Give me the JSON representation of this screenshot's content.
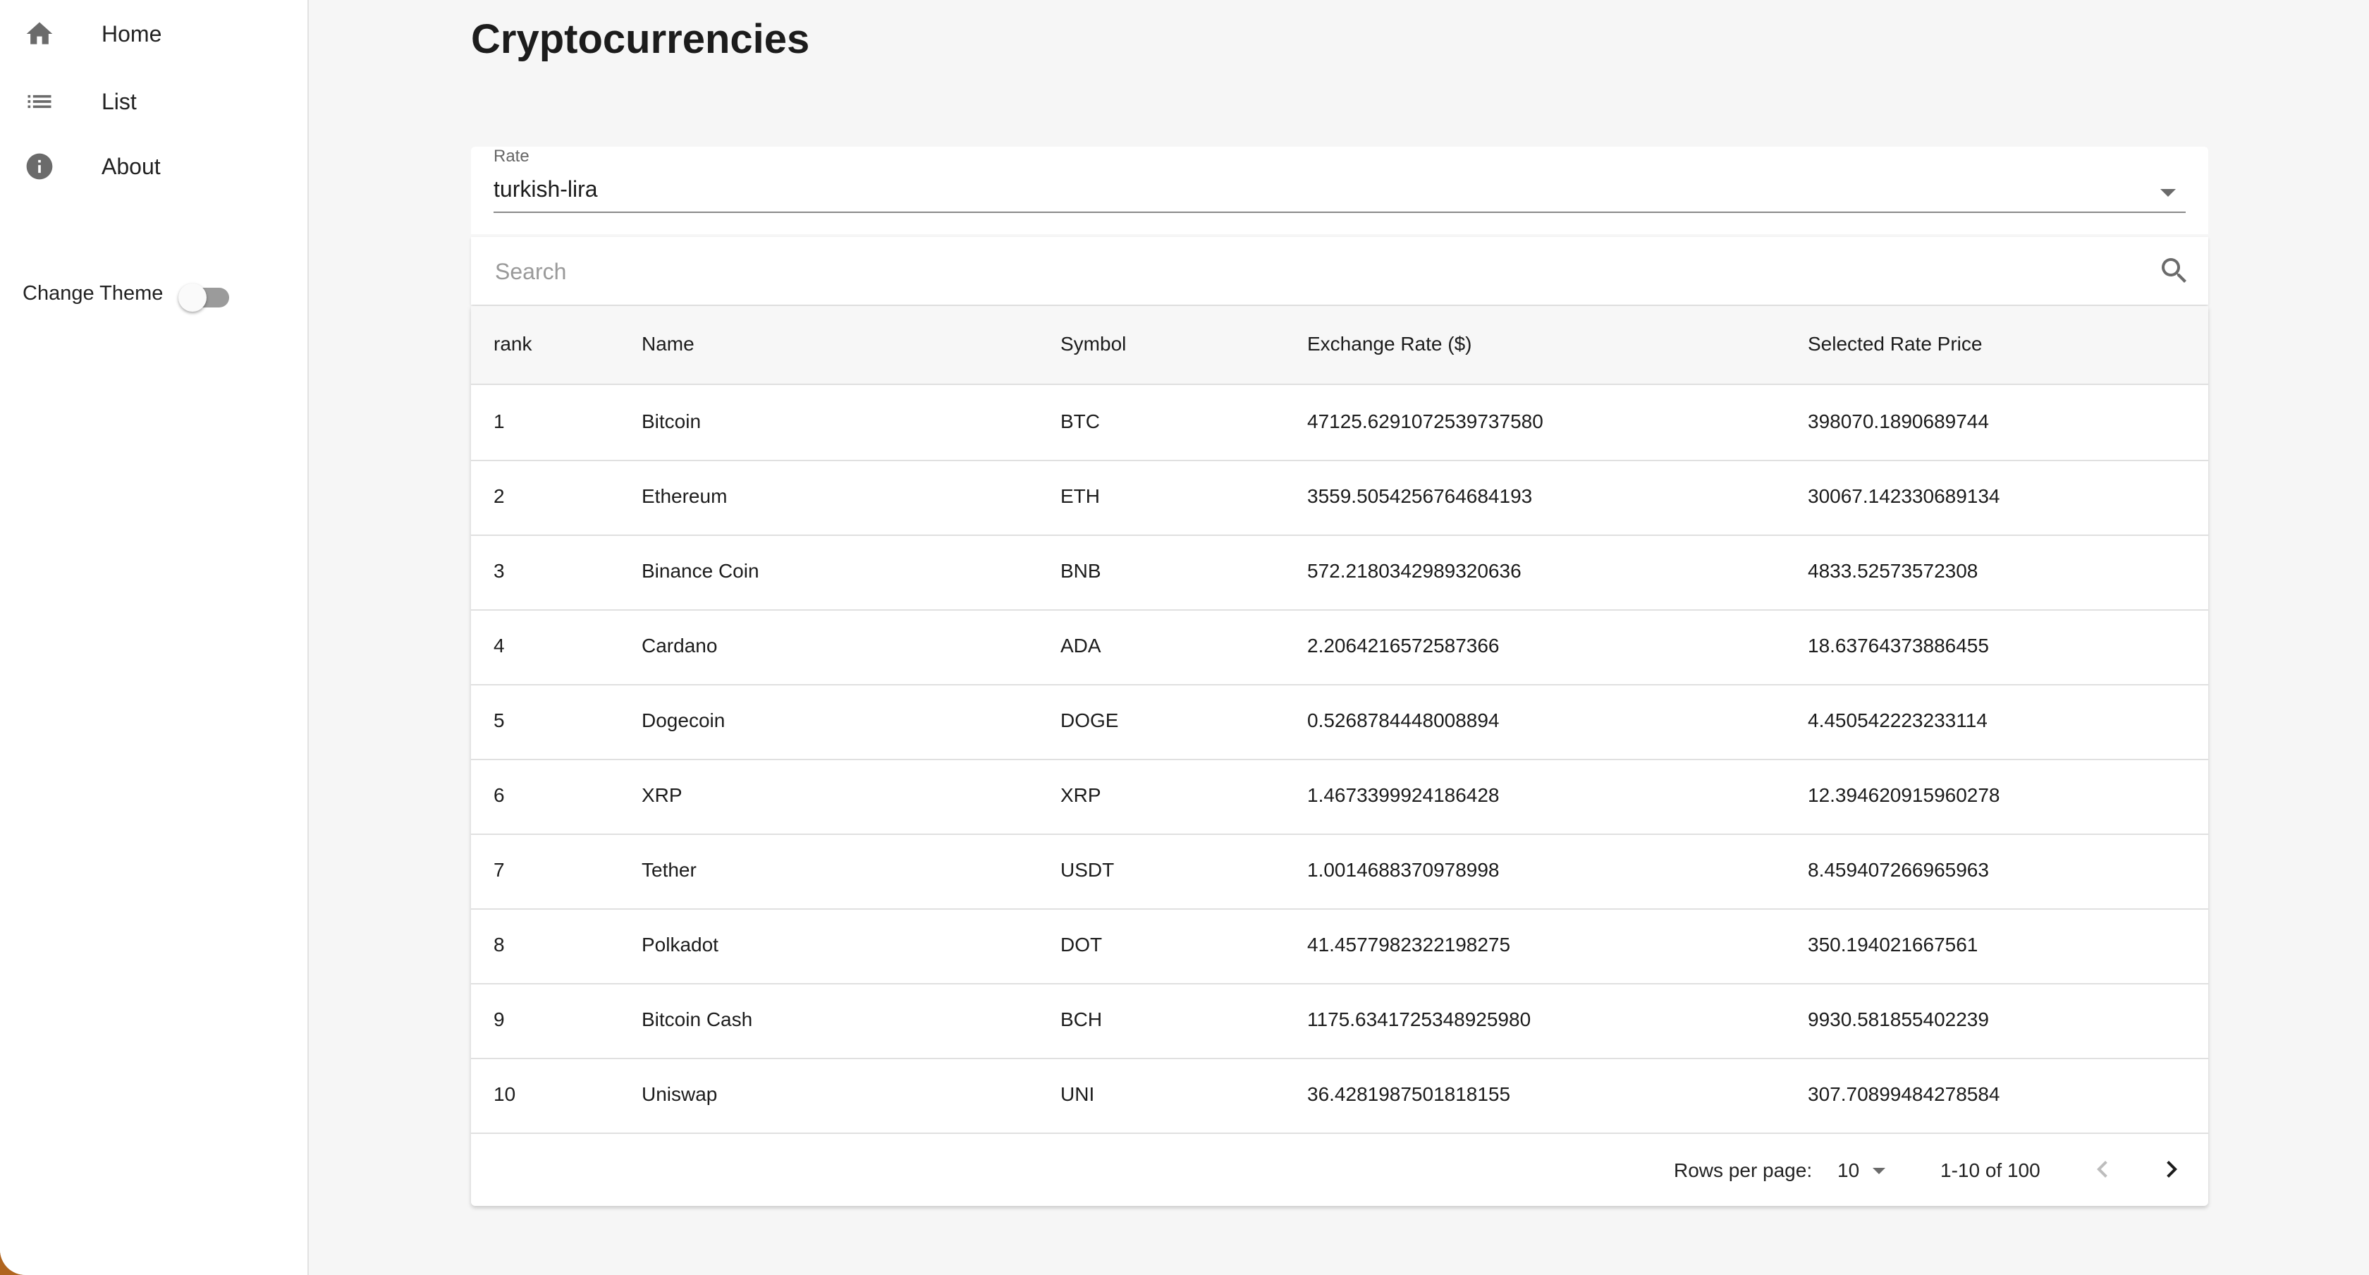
{
  "sidebar": {
    "items": [
      {
        "label": "Home",
        "icon": "home-icon"
      },
      {
        "label": "List",
        "icon": "list-icon"
      },
      {
        "label": "About",
        "icon": "info-icon"
      }
    ],
    "theme_label": "Change Theme",
    "theme_dark": false
  },
  "main": {
    "title": "Cryptocurrencies",
    "rate": {
      "caption": "Rate",
      "value": "turkish-lira"
    },
    "search": {
      "placeholder": "Search"
    },
    "table": {
      "headers": [
        "rank",
        "Name",
        "Symbol",
        "Exchange Rate ($)",
        "Selected Rate Price"
      ],
      "rows": [
        [
          "1",
          "Bitcoin",
          "BTC",
          "47125.6291072539737580",
          "398070.1890689744"
        ],
        [
          "2",
          "Ethereum",
          "ETH",
          "3559.5054256764684193",
          "30067.142330689134"
        ],
        [
          "3",
          "Binance Coin",
          "BNB",
          "572.2180342989320636",
          "4833.52573572308"
        ],
        [
          "4",
          "Cardano",
          "ADA",
          "2.2064216572587366",
          "18.63764373886455"
        ],
        [
          "5",
          "Dogecoin",
          "DOGE",
          "0.5268784448008894",
          "4.450542223233114"
        ],
        [
          "6",
          "XRP",
          "XRP",
          "1.4673399924186428",
          "12.394620915960278"
        ],
        [
          "7",
          "Tether",
          "USDT",
          "1.0014688370978998",
          "8.459407266965963"
        ],
        [
          "8",
          "Polkadot",
          "DOT",
          "41.4577982322198275",
          "350.194021667561"
        ],
        [
          "9",
          "Bitcoin Cash",
          "BCH",
          "1175.6341725348925980",
          "9930.581855402239"
        ],
        [
          "10",
          "Uniswap",
          "UNI",
          "36.4281987501818155",
          "307.70899484278584"
        ]
      ]
    },
    "pagination": {
      "rows_per_page_label": "Rows per page:",
      "rows_per_page_value": "10",
      "range": "1-10 of 100"
    }
  },
  "colors": {
    "sidebar_bg": "#ffffff",
    "page_bg": "#f6f6f6",
    "icon_gray": "#6b6b6b",
    "text": "#1c1c1c"
  }
}
